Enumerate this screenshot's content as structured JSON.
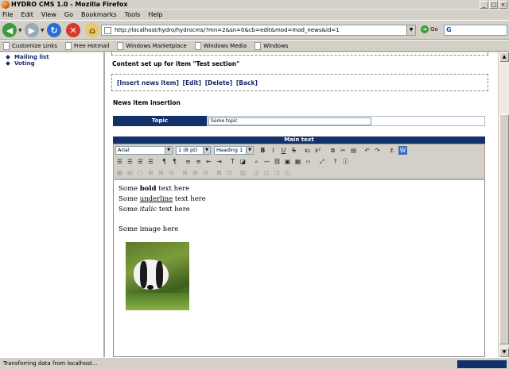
{
  "window": {
    "title": "HYDRO CMS 1.0 - Mozilla Firefox",
    "buttons": [
      "_",
      "□",
      "×"
    ]
  },
  "menu": [
    "File",
    "Edit",
    "View",
    "Go",
    "Bookmarks",
    "Tools",
    "Help"
  ],
  "nav": {
    "url": "http://localhost/hydro/hydrocms/?mn=2&sn=0&cb=edit&mod=mod_news&id=1",
    "go_label": "Go"
  },
  "bookmarks": [
    "Customize Links",
    "Free Hotmail",
    "Windows Marketplace",
    "Windows Media",
    "Windows"
  ],
  "sidebar": {
    "items": [
      "Mailing list",
      "Voting"
    ]
  },
  "main": {
    "setup_title": "Content set up for item \"Test section\"",
    "actions": [
      "[Insert news item]",
      "[Edit]",
      "[Delete]",
      "[Back]"
    ],
    "insert_title": "News item insertion",
    "topic_label": "Topic",
    "topic_value": "Some topic",
    "main_text_label": "Main text"
  },
  "editor_toolbar": {
    "font": "Arial",
    "size": "1 (8 pt)",
    "heading": "Heading 1"
  },
  "editor": {
    "line1_a": "Some ",
    "line1_b": "bold",
    "line1_c": " text here",
    "line2_a": "Some ",
    "line2_b": "underline",
    "line2_c": " text here",
    "line3_a": "Some ",
    "line3_b": "italic",
    "line3_c": " text here",
    "line4": "Some image here"
  },
  "status": {
    "text": "Transferring data from localhost..."
  },
  "colors": {
    "accent": "#12306a",
    "chrome": "#d4d0c8"
  }
}
